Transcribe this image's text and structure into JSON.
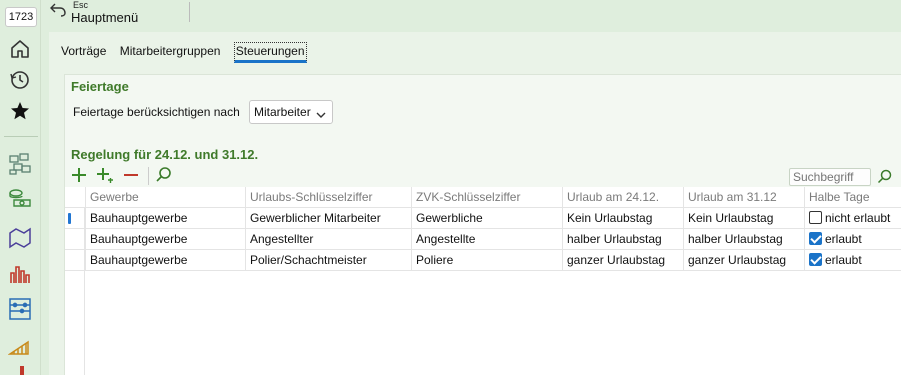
{
  "sidebar": {
    "badge": "1723",
    "icons": [
      "home-icon",
      "history-icon",
      "star-icon",
      "modules-icon",
      "money-icon",
      "map-icon",
      "bar-chart-icon",
      "abacus-icon",
      "ramp-icon"
    ]
  },
  "topbar": {
    "esc_label": "Esc",
    "title": "Hauptmenü"
  },
  "tabs": [
    {
      "label": "Vorträge",
      "active": false
    },
    {
      "label": "Mitarbeitergruppen",
      "active": false
    },
    {
      "label": "Steuerungen",
      "active": true
    }
  ],
  "feiertage": {
    "title": "Feiertage",
    "setting_label": "Feiertage berücksichtigen nach",
    "setting_value": "Mitarbeiter"
  },
  "regelung": {
    "title": "Regelung für 24.12. und 31.12.",
    "search_placeholder": "Suchbegriff",
    "columns": [
      "Gewerbe",
      "Urlaubs-Schlüsselziffer",
      "ZVK-Schlüsselziffer",
      "Urlaub am 24.12.",
      "Urlaub am 31.12",
      "Halbe Tage"
    ],
    "rows": [
      {
        "gewerbe": "Bauhauptgewerbe",
        "urlaubs": "Gewerblicher Mitarbeiter",
        "zvk": "Gewerbliche",
        "u2412": "Kein Urlaubstag",
        "u3112": "Kein Urlaubstag",
        "halbe_checked": false,
        "halbe_text": "nicht erlaubt"
      },
      {
        "gewerbe": "Bauhauptgewerbe",
        "urlaubs": "Angestellter",
        "zvk": "Angestellte",
        "u2412": "halber Urlaubstag",
        "u3112": "halber Urlaubstag",
        "halbe_checked": true,
        "halbe_text": "erlaubt"
      },
      {
        "gewerbe": "Bauhauptgewerbe",
        "urlaubs": "Polier/Schachtmeister",
        "zvk": "Poliere",
        "u2412": "ganzer Urlaubstag",
        "u3112": "ganzer Urlaubstag",
        "halbe_checked": true,
        "halbe_text": "erlaubt"
      }
    ]
  },
  "colors": {
    "accent": "#1a73c8",
    "section_title": "#3f7a2a",
    "background": "#dfeedd",
    "toolbar_green": "#3a8a2a",
    "toolbar_red": "#c0392b"
  }
}
